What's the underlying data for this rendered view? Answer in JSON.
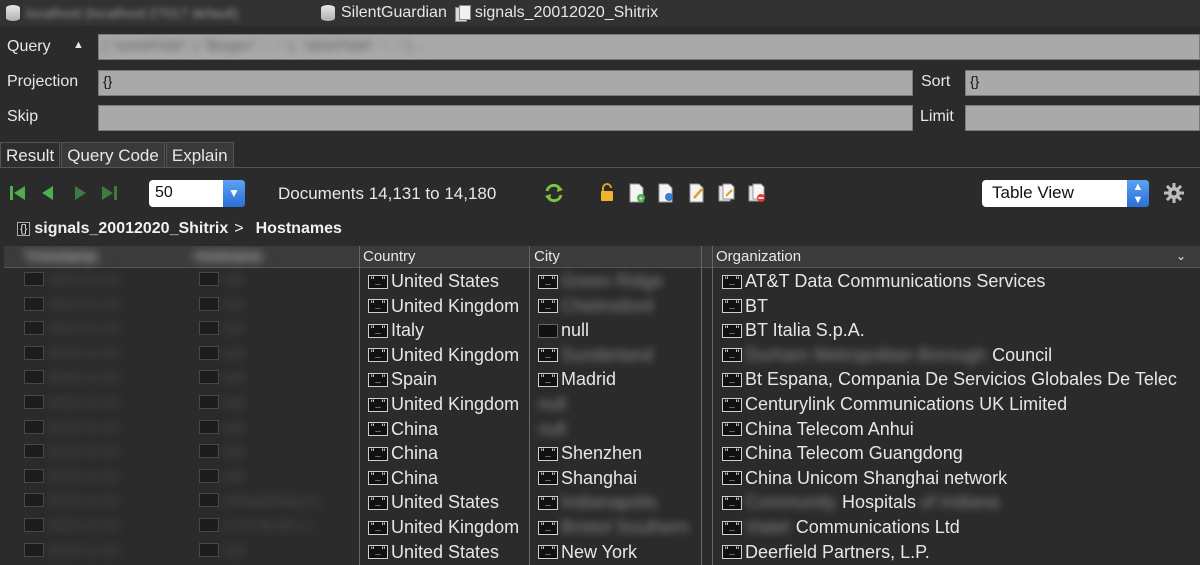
{
  "topbar": {
    "connection": "localhost (localhost:27017 default)",
    "database": "SilentGuardian",
    "collection": "signals_20012020_Shitrix"
  },
  "form": {
    "query_label": "Query",
    "query_value": "{ \"someField\": { \"$regex\": \"...\" }, \"otherField\": \"...\" } ...",
    "projection_label": "Projection",
    "projection_value": "{}",
    "sort_label": "Sort",
    "sort_value": "{}",
    "skip_label": "Skip",
    "skip_value": "",
    "limit_label": "Limit",
    "limit_value": ""
  },
  "tabs": [
    {
      "label": "Result"
    },
    {
      "label": "Query Code"
    },
    {
      "label": "Explain"
    }
  ],
  "toolbar": {
    "page_size": "50",
    "documents_text": "Documents 14,131 to 14,180",
    "view_mode": "Table View"
  },
  "breadcrumb": {
    "collection": "signals_20012020_Shitrix",
    "separator": ">",
    "field": "Hostnames"
  },
  "table": {
    "columns": [
      "Country",
      "City",
      "Organization"
    ],
    "rows": [
      {
        "country": "United States",
        "city": "Green Ridge",
        "org_prefix": "",
        "org": "AT&T Data Communications Services",
        "org_suffix": ""
      },
      {
        "country": "United Kingdom",
        "city": "Chelmsford",
        "org_prefix": "",
        "org": "BT",
        "org_suffix": ""
      },
      {
        "country": "Italy",
        "city": "null",
        "org_prefix": "",
        "org": "BT Italia S.p.A.",
        "org_suffix": ""
      },
      {
        "country": "United Kingdom",
        "city": "Sunderland",
        "org_prefix": "Durham Metropolitan Borough",
        "org": "Council",
        "org_suffix": ""
      },
      {
        "country": "Spain",
        "city": "Madrid",
        "org_prefix": "",
        "org": "Bt Espana, Compania De Servicios Globales De Telec",
        "org_suffix": ""
      },
      {
        "country": "United Kingdom",
        "city": "null",
        "org_prefix": "",
        "org": "Centurylink Communications UK Limited",
        "org_suffix": ""
      },
      {
        "country": "China",
        "city": "null",
        "org_prefix": "",
        "org": "China Telecom Anhui",
        "org_suffix": ""
      },
      {
        "country": "China",
        "city": "Shenzhen",
        "org_prefix": "",
        "org": "China Telecom Guangdong",
        "org_suffix": ""
      },
      {
        "country": "China",
        "city": "Shanghai",
        "org_prefix": "",
        "org": "China Unicom Shanghai network",
        "org_suffix": ""
      },
      {
        "country": "United States",
        "city": "Indianapolis",
        "org_prefix": "Community",
        "org": "Hospitals",
        "org_suffix": "of Indiana"
      },
      {
        "country": "United Kingdom",
        "city": "Bristol Southern",
        "org_prefix": "Viatel",
        "org": "Communications Ltd",
        "org_suffix": ""
      },
      {
        "country": "United States",
        "city": "New York",
        "org_prefix": "",
        "org": "Deerfield Partners, L.P.",
        "org_suffix": ""
      }
    ],
    "hidden_left": [
      {
        "date": "2019-12-16",
        "host": "null"
      },
      {
        "date": "2019-12-16",
        "host": "null"
      },
      {
        "date": "2019-12-16",
        "host": "null"
      },
      {
        "date": "2019-12-16",
        "host": "null"
      },
      {
        "date": "2019-12-16",
        "host": "null"
      },
      {
        "date": "2019-12-16",
        "host": "null"
      },
      {
        "date": "2019-12-16",
        "host": "null"
      },
      {
        "date": "2019-12-16",
        "host": "null"
      },
      {
        "date": "2019-12-16",
        "host": "null"
      },
      {
        "date": "2019-12-16",
        "host": "citrixgateway.co"
      },
      {
        "date": "2019-12-16",
        "host": "[ 170.46.46.1 ]"
      },
      {
        "date": "2019-12-16",
        "host": "null"
      }
    ]
  }
}
